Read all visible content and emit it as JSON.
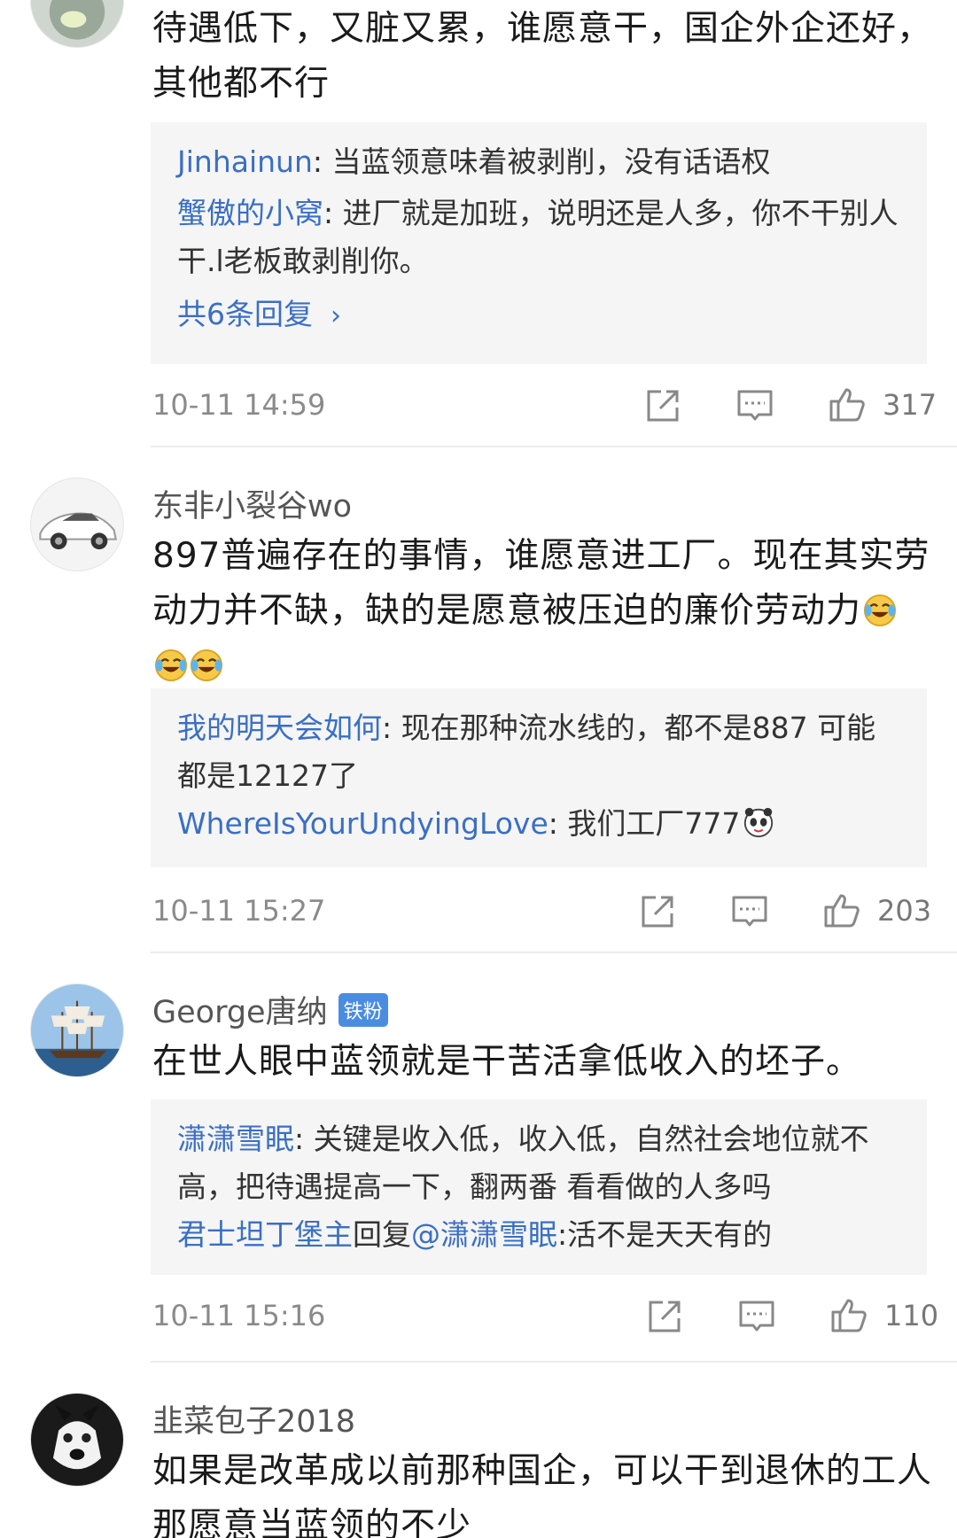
{
  "comments": [
    {
      "username": "",
      "text": "待遇低下，又脏又累，谁愿意干，国企外企还好，其他都不行",
      "replies": [
        {
          "name": "Jinhainun",
          "sep": ": ",
          "text": "当蓝领意味着被剥削，没有话语权"
        },
        {
          "name": "蟹傲的小窝",
          "sep": ": ",
          "text": "进厂就是加班，说明还是人多，你不干别人干.l老板敢剥削你。"
        }
      ],
      "more": "共6条回复",
      "time": "10-11 14:59",
      "likes": "317"
    },
    {
      "username": "东非小裂谷wo",
      "text": "897普遍存在的事情，谁愿意进工厂。现在其实劳动力并不缺，缺的是愿意被压迫的廉价劳动力",
      "emojis": [
        "laugh-cry-emoji",
        "laugh-cry-emoji",
        "laugh-cry-emoji"
      ],
      "replies": [
        {
          "name": "我的明天会如何",
          "sep": ": ",
          "text": "现在那种流水线的，都不是887 可能都是12127了"
        },
        {
          "name": "WhereIsYourUndyingLove",
          "sep": ": ",
          "text": "我们工厂777"
        }
      ],
      "time": "10-11 15:27",
      "likes": "203"
    },
    {
      "username": "George唐纳",
      "badge": "铁粉",
      "text": "在世人眼中蓝领就是干苦活拿低收入的坯子。",
      "replies": [
        {
          "name": "潇潇雪眠",
          "sep": ": ",
          "text": "关键是收入低，收入低，自然社会地位就不高，把待遇提高一下，翻两番 看看做的人多吗"
        },
        {
          "name": "君士坦丁堡主",
          "sep": "回复",
          "mention": "@潇潇雪眠",
          "text": ":活不是天天有的"
        }
      ],
      "time": "10-11 15:16",
      "likes": "110"
    },
    {
      "username": "韭菜包子2018",
      "text": "如果是改革成以前那种国企，可以干到退休的工人 那愿意当蓝领的不少"
    }
  ],
  "icons": {
    "share": "share-icon",
    "comment": "comment-icon",
    "like": "thumbs-up-icon"
  },
  "colors": {
    "link": "#3a6fc4",
    "reply_bg": "#f5f5f5",
    "meta": "#8a8a8a"
  }
}
